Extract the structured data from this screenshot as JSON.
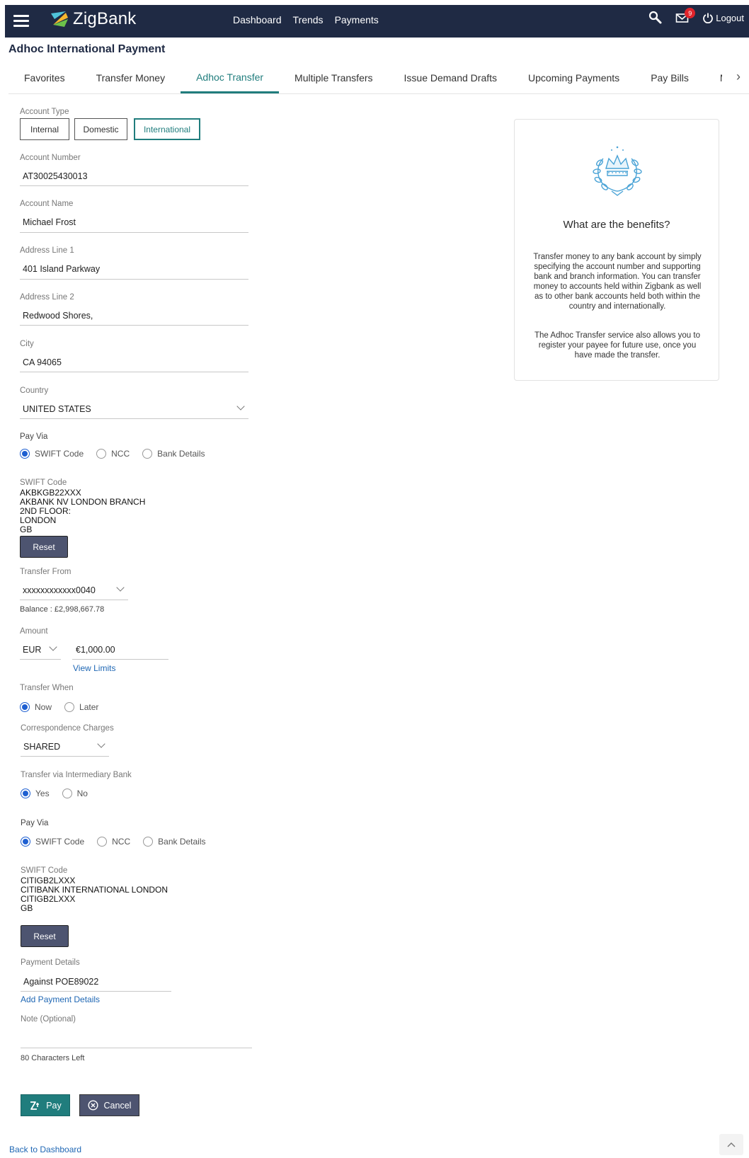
{
  "header": {
    "logo_text": "ZigBank",
    "nav": [
      "Dashboard",
      "Trends",
      "Payments"
    ],
    "mail_badge": "9",
    "logout_label": "Logout"
  },
  "page": {
    "title": "Adhoc International Payment"
  },
  "tabs": [
    "Favorites",
    "Transfer Money",
    "Adhoc Transfer",
    "Multiple Transfers",
    "Issue Demand Drafts",
    "Upcoming Payments",
    "Pay Bills",
    "Multipl"
  ],
  "form": {
    "account_type": {
      "label": "Account Type",
      "options": [
        "Internal",
        "Domestic",
        "International"
      ],
      "selected": "International"
    },
    "account_number": {
      "label": "Account Number",
      "value": "AT30025430013"
    },
    "account_name": {
      "label": "Account Name",
      "value": "Michael Frost"
    },
    "address1": {
      "label": "Address Line 1",
      "value": "401 Island Parkway"
    },
    "address2": {
      "label": "Address Line 2",
      "value": "Redwood Shores,"
    },
    "city": {
      "label": "City",
      "value": "CA 94065"
    },
    "country": {
      "label": "Country",
      "value": "UNITED STATES"
    },
    "pay_via_1": {
      "label": "Pay Via",
      "options": [
        "SWIFT Code",
        "NCC",
        "Bank Details"
      ],
      "selected": "SWIFT Code"
    },
    "swift_1": {
      "label": "SWIFT Code",
      "lines": [
        "AKBKGB22XXX",
        "AKBANK NV LONDON BRANCH",
        "2ND FLOOR:",
        "LONDON",
        "GB"
      ],
      "reset_label": "Reset"
    },
    "transfer_from": {
      "label": "Transfer From",
      "value": "xxxxxxxxxxxx0040",
      "balance": "Balance : £2,998,667.78"
    },
    "amount": {
      "label": "Amount",
      "currency": "EUR",
      "value": "€1,000.00",
      "view_limits": "View Limits"
    },
    "transfer_when": {
      "label": "Transfer When",
      "options": [
        "Now",
        "Later"
      ],
      "selected": "Now"
    },
    "charges": {
      "label": "Correspondence Charges",
      "value": "SHARED"
    },
    "intermediary": {
      "label": "Transfer via Intermediary Bank",
      "options": [
        "Yes",
        "No"
      ],
      "selected": "Yes"
    },
    "pay_via_2": {
      "label": "Pay Via",
      "options": [
        "SWIFT Code",
        "NCC",
        "Bank Details"
      ],
      "selected": "SWIFT Code"
    },
    "swift_2": {
      "label": "SWIFT Code",
      "lines": [
        "CITIGB2LXXX",
        "CITIBANK INTERNATIONAL LONDON",
        "CITIGB2LXXX",
        "GB"
      ],
      "reset_label": "Reset"
    },
    "payment_details": {
      "label": "Payment Details",
      "value": "Against POE89022",
      "add_link": "Add Payment Details"
    },
    "note": {
      "label": "Note (Optional)",
      "value": "",
      "chars_left": "80 Characters Left"
    },
    "pay_label": "Pay",
    "cancel_label": "Cancel"
  },
  "benefits": {
    "title": "What are the benefits?",
    "para1": "Transfer money to any bank account by simply specifying the account number and supporting bank and branch information. You can transfer money to accounts held within Zigbank as well as to other bank accounts held both within the country and internationally.",
    "para2": "The Adhoc Transfer service also allows you to register your payee for future use, once you have made the transfer."
  },
  "footer": {
    "back_link": "Back to Dashboard"
  },
  "colors": {
    "header_bg": "#1f2a44",
    "accent": "#207d7d",
    "button_dark": "#4d5470",
    "link": "#1f67b4",
    "badge": "#e0232b"
  }
}
